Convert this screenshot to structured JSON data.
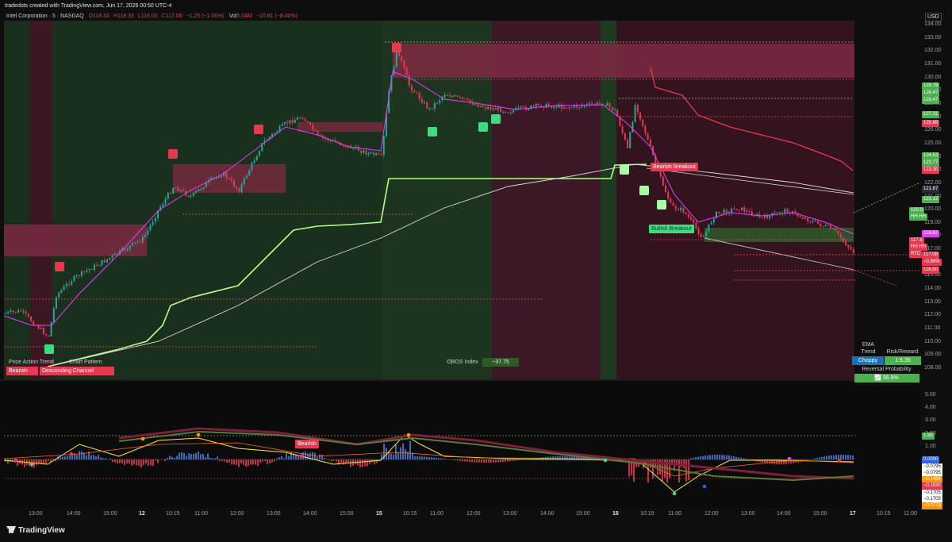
{
  "watermark": "tradedots created with TradingView.com, Jun 17, 2026 00:50 UTC-4",
  "symbol_info": {
    "name": "Intel Corporation · 5 · NASDAQ",
    "o": "O118.33",
    "h": "H118.33",
    "l": "L116.00",
    "c": "C117.08",
    "chg": "−1.25 (−1.06%)",
    "vol_label": "Vol",
    "vol": "5.04M",
    "vol_chg": "−10.81 (−8.40%)"
  },
  "currency": "USD",
  "price_axis": [
    "134.00",
    "133.00",
    "132.00",
    "131.00",
    "130.00",
    "129.00",
    "128.00",
    "127.00",
    "126.00",
    "125.00",
    "124.00",
    "123.00",
    "122.00",
    "121.00",
    "120.00",
    "119.00",
    "118.00",
    "117.00",
    "116.00",
    "115.00",
    "114.00",
    "113.00",
    "112.00",
    "111.00",
    "110.00",
    "109.00",
    "108.00"
  ],
  "price_tags": [
    {
      "text": "128.79",
      "color": "#4caf50"
    },
    {
      "text": "128.47",
      "color": "#4caf50"
    },
    {
      "text": "128.47",
      "color": "#4caf50"
    },
    {
      "text": "127.31",
      "color": "#4caf50"
    },
    {
      "text": "126.86",
      "color": "#e53950"
    },
    {
      "text": "124.53",
      "color": "#4caf50"
    },
    {
      "text": "123.77",
      "color": "#4caf50"
    },
    {
      "text": "123.30",
      "color": "#e53950"
    },
    {
      "text": "121.87",
      "color": "#2a2e39"
    },
    {
      "text": "121.12",
      "color": "#4caf50"
    },
    {
      "text": "120.0",
      "color": "#4caf50"
    },
    {
      "text": "HH HH",
      "color": "#4caf50"
    },
    {
      "text": "118.62",
      "color": "#e040fb"
    },
    {
      "text": "117.8",
      "color": "#e53950"
    },
    {
      "text": "HH HH",
      "color": "#e53950"
    },
    {
      "text": "117.08",
      "color": "#e53950"
    },
    {
      "text": "RTC",
      "color": "#e53950"
    },
    {
      "text": "−0.86%",
      "color": "#e53950"
    },
    {
      "text": "116.00",
      "color": "#e53950"
    }
  ],
  "osc_axis": [
    "5.00",
    "4.00",
    "3.00",
    "2.00",
    "1.00",
    "0.00"
  ],
  "osc_tags": [
    {
      "text": "1.55",
      "color": "#4caf50"
    },
    {
      "text": "0.0000",
      "color": "#2962ff"
    },
    {
      "text": "−0.0795",
      "color": "#ffffff"
    },
    {
      "text": "−0.0795",
      "color": "#ffffff"
    },
    {
      "text": "−0.1468",
      "color": "#ff9800"
    },
    {
      "text": "−0.1530",
      "color": "#e53950"
    },
    {
      "text": "−0.1705",
      "color": "#ffffff"
    },
    {
      "text": "−0.1705",
      "color": "#ffffff"
    },
    {
      "text": "−0.2773",
      "color": "#ff9800"
    }
  ],
  "time_axis": [
    "13:00",
    "14:00",
    "15:00",
    "12",
    "10:15",
    "11:00",
    "12:00",
    "13:00",
    "14:00",
    "15:00",
    "15",
    "10:15",
    "11:00",
    "12:00",
    "13:00",
    "14:00",
    "15:00",
    "16",
    "10:15",
    "11:00",
    "12:00",
    "13:00",
    "14:00",
    "15:00",
    "17",
    "10:15",
    "11:00"
  ],
  "chart_labels": {
    "bearish_breakout": "Bearish Breakout",
    "bullish_breakout": "Bullish Breakout",
    "price_action_trend": "Price Action Trend",
    "chart_pattern": "Chart Pattern",
    "bearish": "Bearish",
    "descending_channel": "Descending Channel",
    "bearish_small": "Bearish",
    "obos_title": "OBOS Index",
    "obos_value": "−37.75"
  },
  "right_table": {
    "ema_trend_label": "EMA Trend",
    "risk_reward_label": "Risk/Reward",
    "ema_trend_value": "Choppy",
    "risk_reward_value": "1:5.35",
    "reversal_label": "Reversal Probability",
    "reversal_value": "96.9%"
  },
  "brand": "TradingView",
  "colors": {
    "bull": "#26a69a",
    "bear": "#e53950",
    "accent": "#2962ff",
    "lime": "#b6ff8a",
    "magenta": "#e040fb"
  }
}
